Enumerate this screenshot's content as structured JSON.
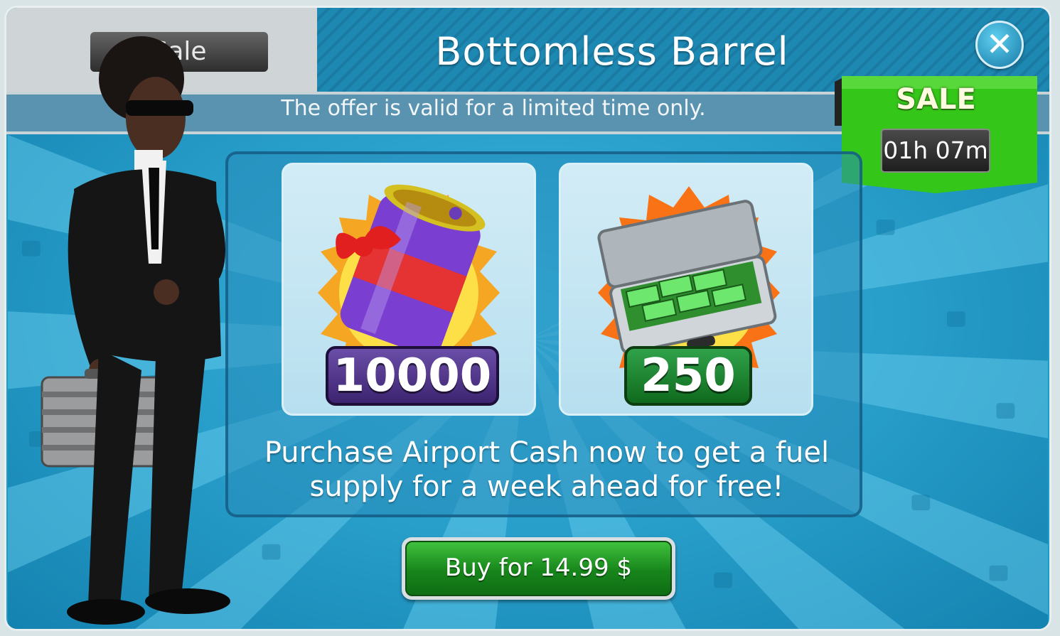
{
  "tab": {
    "label": "Sale"
  },
  "header": {
    "title": "Bottomless Barrel",
    "subtitle": "The offer is valid for a limited time only."
  },
  "sale": {
    "label": "SALE",
    "timer": "01h 07m"
  },
  "items": [
    {
      "name": "fuel-barrel",
      "amount": "10000"
    },
    {
      "name": "airport-cash-case",
      "amount": "250"
    }
  ],
  "description": "Purchase Airport Cash now to get a fuel supply for a week ahead for free!",
  "buy": {
    "label": "Buy for 14.99 $"
  },
  "colors": {
    "accent": "#1d9ec9",
    "sale_green": "#3cc21a",
    "buy_green": "#17851b",
    "fuel_purple": "#4a2e88"
  }
}
